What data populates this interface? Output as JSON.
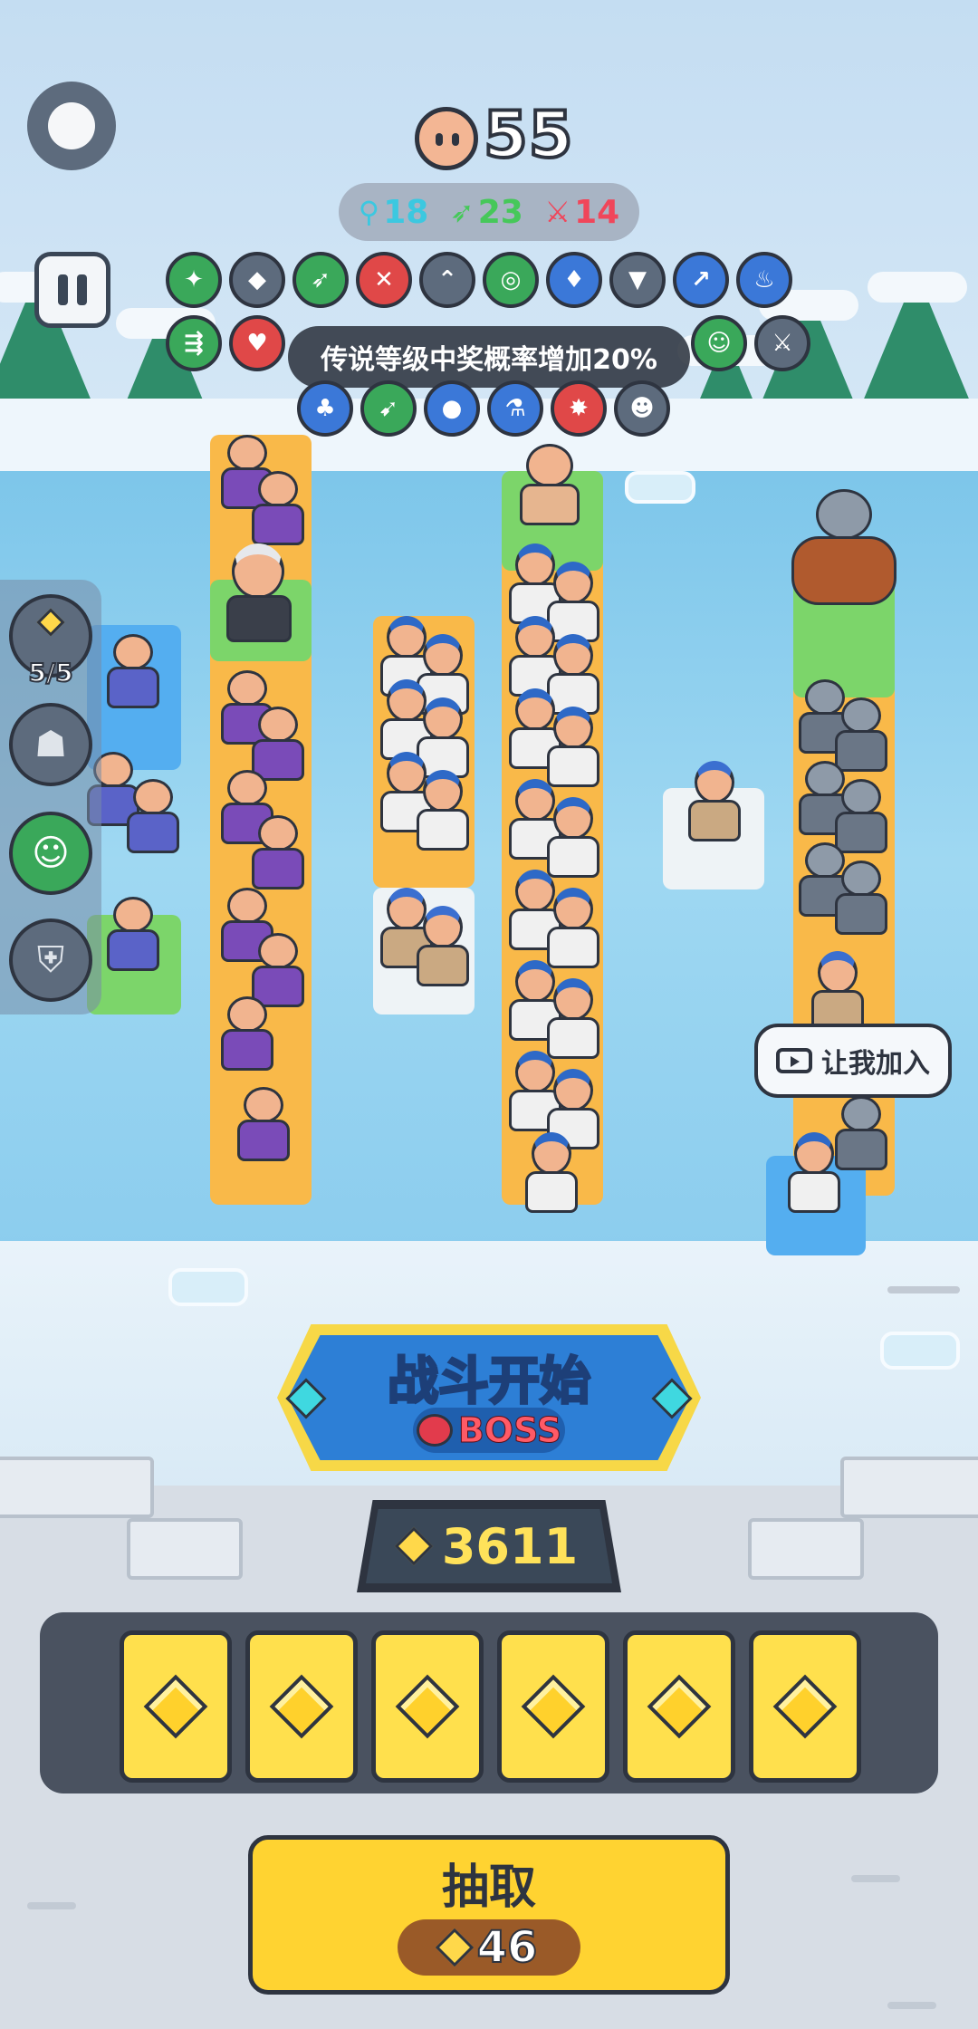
{
  "hud": {
    "wave_count": "55",
    "class_counts": [
      {
        "icon": "mage-staff-icon",
        "value": "18",
        "color": "#3cc8e0"
      },
      {
        "icon": "bow-icon",
        "value": "23",
        "color": "#46c85a"
      },
      {
        "icon": "sword-icon",
        "value": "14",
        "color": "#f0465a"
      }
    ]
  },
  "buffs": {
    "row1": [
      "crit-buff-icon",
      "rank-up-buff-icon",
      "bow-buff-icon",
      "slash-buff-icon",
      "double-rank-buff-icon",
      "target-buff-icon",
      "purple-flame-buff-icon",
      "gem-down-buff-icon",
      "arrows-up-buff-icon",
      "fire-buff-icon"
    ],
    "row2": [
      "multi-arrow-buff-icon",
      "heal-buff-icon",
      "",
      "",
      "",
      "",
      "",
      "",
      "party-buff-icon",
      "swords-buff-icon"
    ],
    "row3": [
      "clover-card-buff-icon",
      "arrow-rain-buff-icon",
      "coins-buff-icon",
      "potion-buff-icon",
      "mob-buff-icon",
      "crowd-buff-icon"
    ],
    "tooltip": "传说等级中奖概率增加20%"
  },
  "side_panel": {
    "slot_count": "5/5",
    "icons": [
      "gem-slots-icon",
      "knight-squad-icon",
      "archer-squad-icon",
      "armored-squad-icon"
    ]
  },
  "join": {
    "label": "让我加入"
  },
  "battle": {
    "label": "战斗开始",
    "boss_label": "BOSS"
  },
  "currency": {
    "gems": "3611"
  },
  "cards": {
    "count_visible": 6,
    "icon": "gem-icon"
  },
  "draw": {
    "label": "抽取",
    "cost": "46"
  },
  "colors": {
    "accent_blue": "#2d7fd6",
    "button_yellow": "#ffd331",
    "gem_yellow": "#ffe25a",
    "dark_outline": "#2e3440"
  }
}
